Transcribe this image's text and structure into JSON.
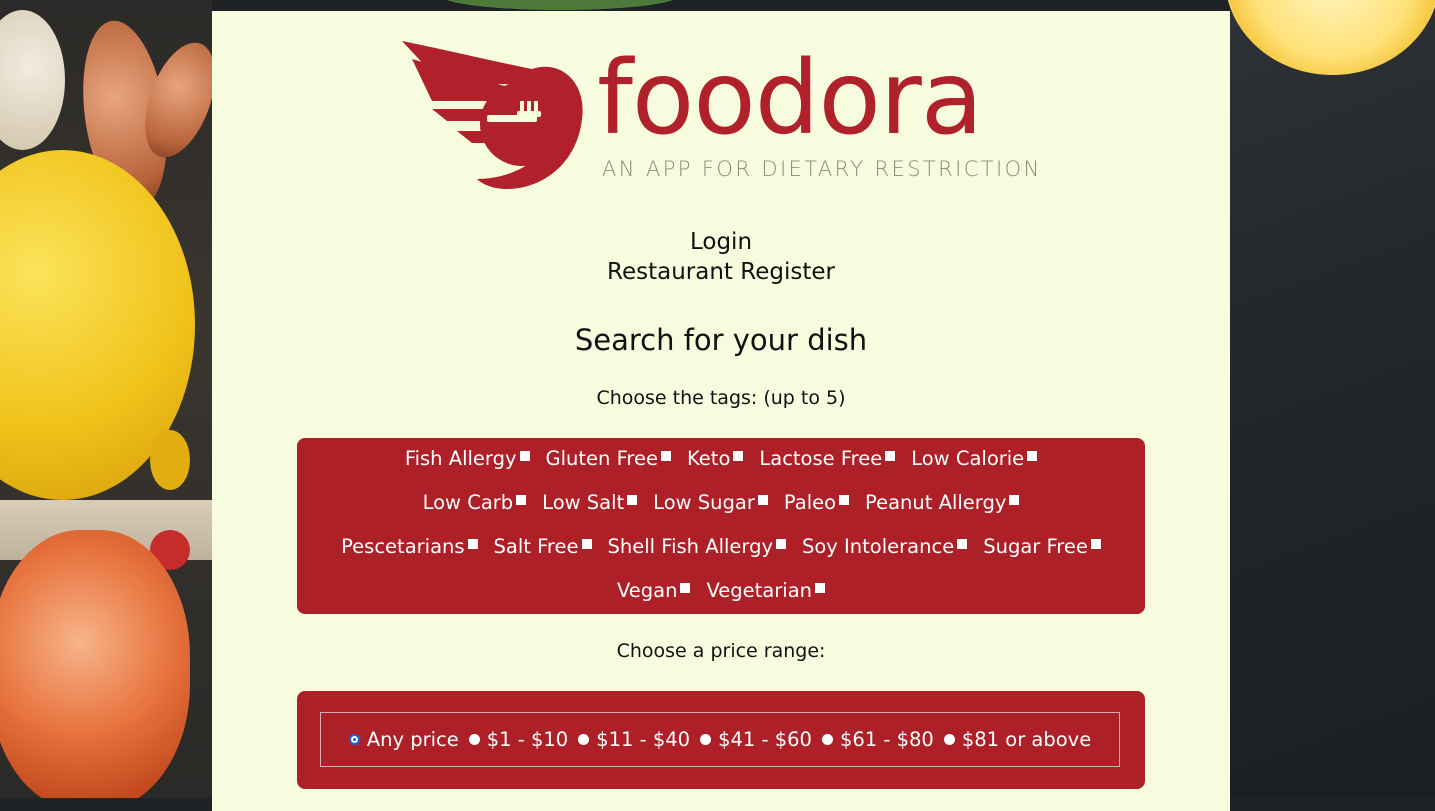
{
  "brand": {
    "name": "foodora",
    "tagline": "AN APP FOR DIETARY RESTRICTION",
    "color": "#b0212b"
  },
  "nav": {
    "login": "Login",
    "restaurant_register": "Restaurant Register"
  },
  "search": {
    "title": "Search for your dish",
    "tags_prompt": "Choose the tags: (up to 5)",
    "tag_rows": [
      [
        "Fish Allergy",
        "Gluten Free",
        "Keto",
        "Lactose Free",
        "Low Calorie"
      ],
      [
        "Low Carb",
        "Low Salt",
        "Low Sugar",
        "Paleo",
        "Peanut Allergy"
      ],
      [
        "Pescetarians",
        "Salt Free",
        "Shell Fish Allergy",
        "Soy Intolerance",
        "Sugar Free"
      ],
      [
        "Vegan",
        "Vegetarian"
      ]
    ],
    "price_prompt": "Choose a price range:",
    "price_options": [
      "Any price",
      "$1 - $10",
      "$11 - $40",
      "$41 - $60",
      "$61 - $80",
      "$81 or above"
    ],
    "price_selected": "Any price"
  },
  "colors": {
    "panel_bg": "#f8fcdf",
    "accent": "#ae2028"
  }
}
